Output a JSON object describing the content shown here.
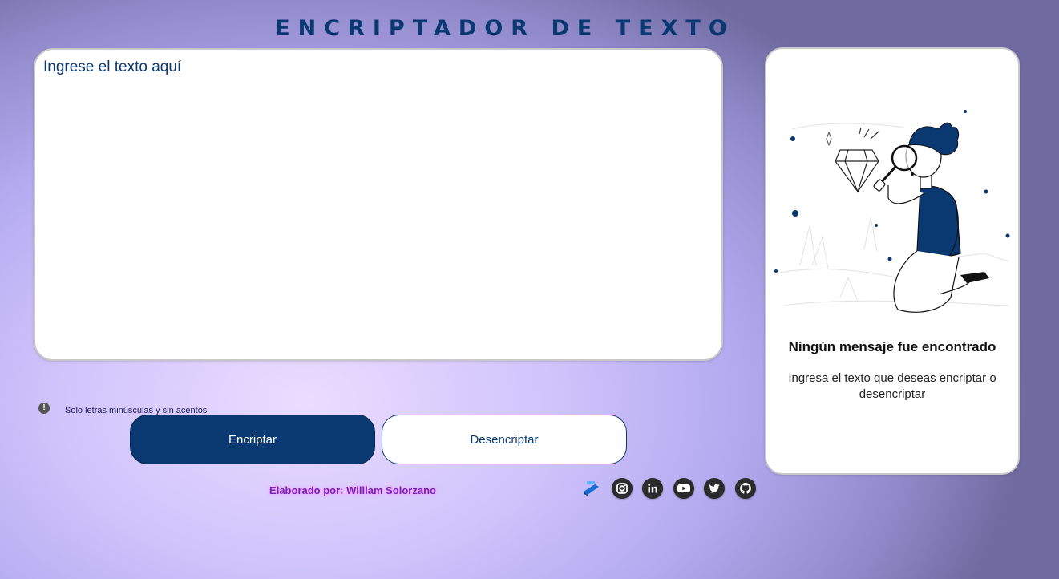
{
  "header": {
    "title": "ENCRIPTADOR DE TEXTO"
  },
  "editor": {
    "placeholder": "Ingrese el texto aquí"
  },
  "hint": {
    "icon": "info-icon",
    "text": "Solo letras minúsculas y sin acentos"
  },
  "buttons": {
    "encrypt_label": "Encriptar",
    "decrypt_label": "Desencriptar"
  },
  "footer": {
    "credit": "Elaborado por: William Solorzano",
    "socials": [
      {
        "name": "alura-icon"
      },
      {
        "name": "instagram-icon"
      },
      {
        "name": "linkedin-icon"
      },
      {
        "name": "youtube-icon"
      },
      {
        "name": "twitter-icon"
      },
      {
        "name": "github-icon"
      }
    ]
  },
  "output_panel": {
    "title": "Ningún mensaje fue encontrado",
    "description": "Ingresa el texto que deseas encriptar o desencriptar"
  },
  "colors": {
    "primary": "#0a3871",
    "background_light": "#ecdcff",
    "background_dark": "#6f6ba0",
    "credit": "#7a1fb8"
  }
}
